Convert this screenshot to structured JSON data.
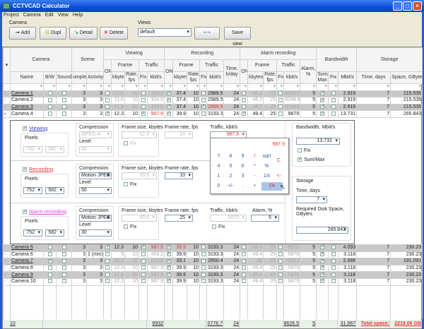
{
  "window": {
    "title": "CCTVCAD Calculator"
  },
  "menu": [
    "Project",
    "Camera",
    "Edit",
    "View",
    "Help"
  ],
  "toolbar": {
    "camera_label": "Camera",
    "add": "Add",
    "dupl": "Dupl",
    "detail": "Detail",
    "delete": "Delete",
    "views_label": "Views",
    "view_value": "default",
    "save_view": "Save view"
  },
  "headers": {
    "camera": "Camera",
    "scene": "Scene",
    "viewing": "Viewing",
    "recording": "Recording",
    "alarm_recording": "Alarm recording",
    "bandwidth": "Bandwidth",
    "storage": "Storage",
    "on": "ON",
    "frame": "Frame",
    "traffic": "Traffic",
    "size": "Size",
    "rate": "Rate, fps",
    "kbytes": "kbytes",
    "fix": "Fix",
    "kbits": "kbit/s",
    "time_hday": "Time, h/day",
    "alarm_pct": "Alarm, %",
    "name": "Name",
    "bw": "B/W",
    "sound": "Sound",
    "complex": "omplex",
    "activity": "Activity",
    "summax": "Sum/ Max",
    "mbits": "Mbit/s",
    "time_days": "Time, days",
    "space": "Space, GByte"
  },
  "rows": [
    [
      "Camera 1",
      0,
      0,
      "3",
      "3",
      0,
      "11.6",
      "10",
      0,
      "324.8",
      1,
      "37.4",
      "10",
      0,
      "2989.5",
      "24",
      0,
      "46.2",
      "25",
      0,
      "8248.5",
      "5",
      1,
      0,
      "2.919",
      "7",
      "215.535"
    ],
    [
      "Camera 2",
      0,
      0,
      "3",
      "3",
      0,
      "11.6",
      "10",
      0,
      "324.8",
      1,
      "37.4",
      "10",
      0,
      "2989.5",
      "24",
      0,
      "46.2",
      "25",
      0,
      "8248.5",
      "5",
      1,
      0,
      "2.919",
      "7",
      "215.535"
    ],
    [
      "Camera 3",
      0,
      0,
      "3",
      "3",
      0,
      "11.6",
      "10",
      0,
      "324.8",
      1,
      "37.4",
      "10",
      1,
      "2989.5",
      "24",
      0,
      "46.2",
      "25",
      0,
      "8248.5",
      "5",
      1,
      0,
      "2.919",
      "7",
      "215.535"
    ],
    [
      "Camera 4",
      0,
      0,
      "3",
      "3",
      1,
      "12.3",
      "10",
      1,
      "987.9",
      1,
      "39.9",
      "10",
      0,
      "3193.3",
      "24",
      1,
      "49.4",
      "25",
      0,
      "9879",
      "5",
      1,
      0,
      "13.731",
      "7",
      "265.843"
    ],
    [
      "Camera 5",
      0,
      0,
      "3",
      "3",
      1,
      "12.3",
      "10",
      1,
      "987.9",
      1,
      "39.9",
      "10",
      0,
      "3193.3",
      "24",
      0,
      "49.4",
      "25",
      0,
      "9879",
      "5",
      1,
      0,
      "4.093",
      "7",
      "230.23"
    ],
    [
      "Camera 6",
      0,
      0,
      "3",
      "1 (min)",
      0,
      "5",
      "10",
      0,
      "403.2",
      1,
      "39.9",
      "10",
      0,
      "3193.3",
      "24",
      0,
      "49.4",
      "25",
      0,
      "9879",
      "5",
      1,
      0,
      "3.118",
      "7",
      "230.23"
    ],
    [
      "Camera 7",
      1,
      0,
      "3",
      "3",
      0,
      "10.2",
      "10",
      0,
      "813.9",
      1,
      "33.1",
      "10",
      0,
      "2650.4",
      "24",
      0,
      "38",
      "25",
      0,
      "7606.5",
      "5",
      1,
      0,
      "2.588",
      "7",
      "191.091"
    ],
    [
      "Camera 8",
      0,
      0,
      "3",
      "3",
      0,
      "12.3",
      "10",
      0,
      "987.9",
      1,
      "39.9",
      "10",
      0,
      "3193.3",
      "24",
      0,
      "49.4",
      "25",
      0,
      "9879",
      "5",
      1,
      0,
      "3.118",
      "7",
      "230.23"
    ],
    [
      "Camera 9",
      0,
      0,
      "3",
      "3",
      0,
      "12.3",
      "10",
      0,
      "987.9",
      1,
      "39.9",
      "10",
      0,
      "3193.3",
      "24",
      0,
      "49.4",
      "25",
      0,
      "9879",
      "5",
      1,
      0,
      "3.118",
      "7",
      "230.23"
    ],
    [
      "Camera 10",
      0,
      0,
      "3",
      "3",
      0,
      "12.3",
      "10",
      0,
      "987.9",
      1,
      "39.9",
      "10",
      0,
      "3193.3",
      "24",
      0,
      "49.4",
      "25",
      0,
      "9879",
      "5",
      1,
      0,
      "3.118",
      "7",
      "230.23"
    ]
  ],
  "detail": {
    "viewing": {
      "title": "Viewing",
      "pixels_label": "Pixels",
      "w": "752",
      "h": "582",
      "compression_label": "Compression",
      "compression": "MPEG-4",
      "level_label": "Level",
      "level": "50",
      "frame_size_label": "Frame size, kbytes",
      "frame_size": "12.3",
      "fix_label": "Fix",
      "frame_rate_label": "Frame rate, fps",
      "frame_rate": "10",
      "traffic_label": "Traffic, kbit/s",
      "traffic": "987.9"
    },
    "recording": {
      "title": "Recording",
      "pixels_label": "Pixels",
      "w": "752",
      "h": "582",
      "compression_label": "Compression",
      "compression": "Motion JPEG",
      "level_label": "Level",
      "level": "50",
      "frame_size_label": "Frame size, kbytes",
      "frame_size": "39.9",
      "fix_label": "Fix",
      "frame_rate_label": "Frame rate, fps",
      "frame_rate": "10"
    },
    "alarm": {
      "title": "Alarm recording",
      "pixels_label": "Pixels",
      "w": "752",
      "h": "582",
      "compression_label": "Compression",
      "compression": "Motion JPEG",
      "level_label": "Level",
      "level": "30",
      "frame_size_label": "Frame size, kbytes",
      "frame_size": "49.4",
      "fix_label": "Fix",
      "frame_rate_label": "Frame rate, fps",
      "frame_rate": "25",
      "traffic_label": "Traffic, kbit/s",
      "traffic": "9879",
      "alarm_label": "Alarm, %",
      "alarm": "5"
    },
    "bandwidth": {
      "label": "Bandwidth, Mbit/s",
      "value": "13.731",
      "fix_label": "Fix",
      "summax_label": "Sum/Max"
    },
    "storage": {
      "label": "Storage",
      "time_label": "Time, days",
      "time": "7",
      "space_label": "Required Disk Space, GBytes",
      "space": "265.843"
    },
    "calculator": {
      "display": "987.9",
      "keys": [
        "7",
        "8",
        "9",
        "/",
        "sqrt",
        "C",
        "4",
        "5",
        "6",
        "*",
        "%",
        "",
        "1",
        "2",
        "3",
        "-",
        "1/x",
        "<-",
        "0",
        "+/-",
        ".",
        "+",
        "Ok",
        ""
      ]
    }
  },
  "footer": {
    "count": "10",
    "v_traffic": "8932",
    "r_traffic": "0778.7",
    "time": "24",
    "a_traffic": "8626.5",
    "alarm": "5",
    "mbits": "31.987",
    "total_label": "Total space:",
    "total": "2219.06 GB"
  },
  "colors": {
    "accent_red": "#e33",
    "title_bar": "#0a4fd6"
  }
}
